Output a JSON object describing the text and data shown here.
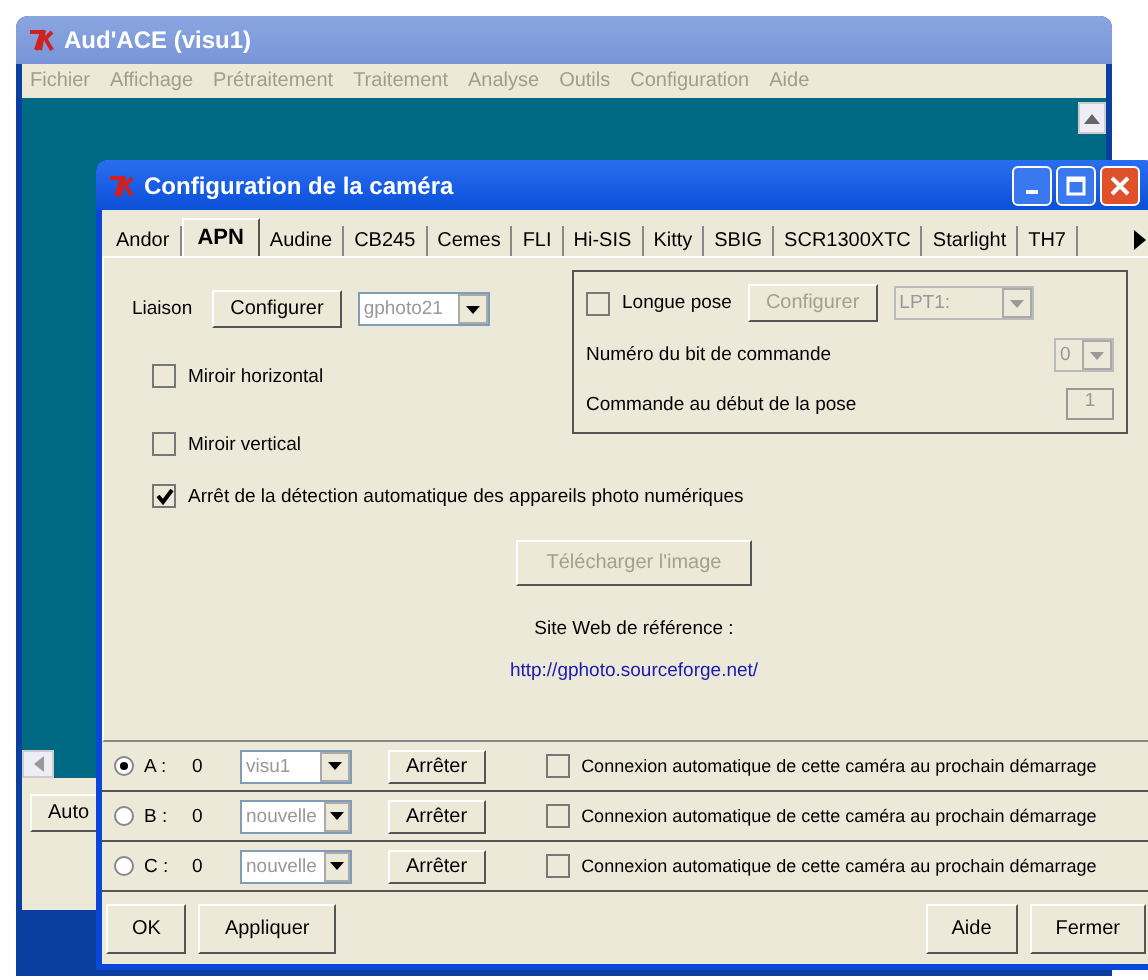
{
  "main_window": {
    "title": "Aud'ACE (visu1)",
    "menu": [
      {
        "label": "Fichier",
        "disabled": true
      },
      {
        "label": "Affichage",
        "disabled": true
      },
      {
        "label": "Prétraitement",
        "disabled": true
      },
      {
        "label": "Traitement",
        "disabled": true
      },
      {
        "label": "Analyse",
        "disabled": true
      },
      {
        "label": "Outils",
        "disabled": true
      },
      {
        "label": "Configuration",
        "disabled": true
      },
      {
        "label": "Aide",
        "disabled": true
      }
    ],
    "auto_button": "Auto"
  },
  "dialog": {
    "title": "Configuration de la caméra",
    "tabs": [
      {
        "label": "Andor",
        "selected": false
      },
      {
        "label": "APN",
        "selected": true
      },
      {
        "label": "Audine",
        "selected": false
      },
      {
        "label": "CB245",
        "selected": false
      },
      {
        "label": "Cemes",
        "selected": false
      },
      {
        "label": "FLI",
        "selected": false
      },
      {
        "label": "Hi-SIS",
        "selected": false
      },
      {
        "label": "Kitty",
        "selected": false
      },
      {
        "label": "SBIG",
        "selected": false
      },
      {
        "label": "SCR1300XTC",
        "selected": false
      },
      {
        "label": "Starlight",
        "selected": false
      },
      {
        "label": "TH7",
        "selected": false
      }
    ],
    "liaison": {
      "label": "Liaison",
      "button": "Configurer",
      "select_value": "gphoto21"
    },
    "options": [
      {
        "label": "Miroir horizontal",
        "checked": false
      },
      {
        "label": "Miroir vertical",
        "checked": false
      },
      {
        "label": "Arrêt de la détection automatique des appareils photo numériques",
        "checked": true
      }
    ],
    "long_pose": {
      "label": "Longue pose",
      "checked": false,
      "button": "Configurer",
      "button_disabled": true,
      "port": "LPT1:",
      "bit_label": "Numéro du bit de commande",
      "bit_value": "0",
      "command_label": "Commande au début de la pose",
      "command_value": "1"
    },
    "download_button": {
      "label": "Télécharger l'image",
      "disabled": true
    },
    "site_label": "Site Web de référence :",
    "site_url": "http://gphoto.sourceforge.net/",
    "cameras": [
      {
        "letter": "A :",
        "number": "0",
        "selected": true,
        "source": "visu1",
        "button": "Arrêter",
        "auto_label": "Connexion automatique de cette caméra au prochain démarrage",
        "auto_checked": false
      },
      {
        "letter": "B :",
        "number": "0",
        "selected": false,
        "source": "nouvelle",
        "button": "Arrêter",
        "auto_label": "Connexion automatique de cette caméra au prochain démarrage",
        "auto_checked": false
      },
      {
        "letter": "C :",
        "number": "0",
        "selected": false,
        "source": "nouvelle",
        "button": "Arrêter",
        "auto_label": "Connexion automatique de cette caméra au prochain démarrage",
        "auto_checked": false
      }
    ],
    "buttons_left": [
      "OK",
      "Appliquer"
    ],
    "buttons_right": [
      "Aide",
      "Fermer"
    ]
  }
}
